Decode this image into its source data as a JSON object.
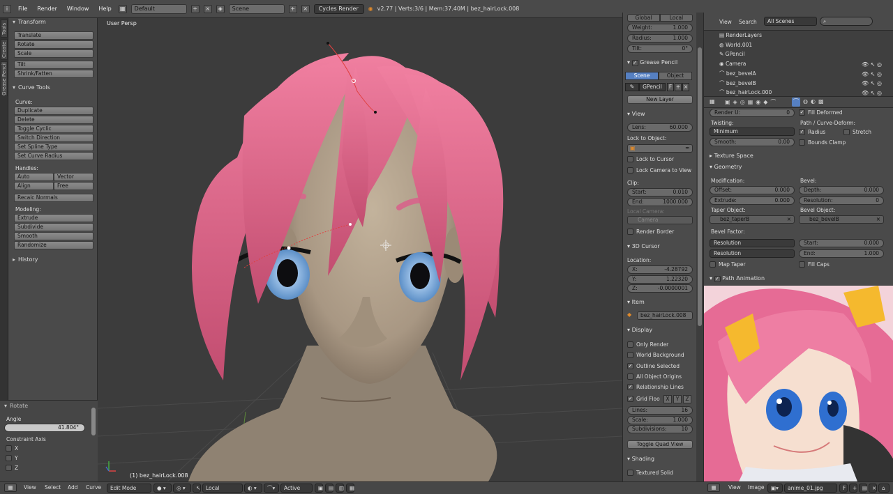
{
  "topbar": {
    "menus": [
      "File",
      "Render",
      "Window",
      "Help"
    ],
    "layout": "Default",
    "scene": "Scene",
    "engine": "Cycles Render",
    "info": "v2.77 | Verts:3/6 | Mem:37.40M | bez_hairLock.008"
  },
  "vtabs": [
    "Tools",
    "Create",
    "Grease Pencil"
  ],
  "toolshelf": {
    "transform_header": "Transform",
    "transform_buttons": [
      "Translate",
      "Rotate",
      "Scale",
      "Tilt",
      "Shrink/Fatten"
    ],
    "curve_tools_header": "Curve Tools",
    "curve_label": "Curve:",
    "curve_buttons": [
      "Duplicate",
      "Delete",
      "Toggle Cyclic",
      "Switch Direction",
      "Set Spline Type",
      "Set Curve Radius"
    ],
    "handles_label": "Handles:",
    "handles": [
      "Auto",
      "Vector",
      "Align",
      "Free"
    ],
    "recalc": "Recalc Normals",
    "modeling_label": "Modeling:",
    "modeling_buttons": [
      "Extrude",
      "Subdivide",
      "Smooth",
      "Randomize"
    ],
    "history_header": "History",
    "rotate_header": "Rotate",
    "angle_label": "Angle",
    "angle_value": "41.804°",
    "constraint_label": "Constraint Axis",
    "axes": [
      "X",
      "Y",
      "Z"
    ]
  },
  "viewport": {
    "view_label": "User Persp",
    "object_label": "(1) bez_hairLock.008"
  },
  "npanel": {
    "tabs": [
      "Global",
      "Local"
    ],
    "weight": {
      "label": "Weight:",
      "value": "1.000"
    },
    "radius": {
      "label": "Radius:",
      "value": "1.000"
    },
    "tilt": {
      "label": "Tilt:",
      "value": "0°"
    },
    "grease_header": "Grease Pencil",
    "grease_tabs": [
      "Scene",
      "Object"
    ],
    "gpencil": "GPencil",
    "gpencil_f": "F",
    "new_layer": "New Layer",
    "view_header": "View",
    "lens": {
      "label": "Lens:",
      "value": "60.000"
    },
    "lock_label": "Lock to Object:",
    "lock_cursor": "Lock to Cursor",
    "lock_camera": "Lock Camera to View",
    "clip_label": "Clip:",
    "clip_start": {
      "label": "Start:",
      "value": "0.010"
    },
    "clip_end": {
      "label": "End:",
      "value": "1000.000"
    },
    "local_camera": "Local Camera:",
    "camera": "Camera",
    "render_border": "Render Border",
    "cursor_header": "3D Cursor",
    "location_label": "Location:",
    "cx": {
      "label": "X:",
      "value": "-4.28792"
    },
    "cy": {
      "label": "Y:",
      "value": "1.22320"
    },
    "cz": {
      "label": "Z:",
      "value": "-0.0000001"
    },
    "item_header": "Item",
    "item_name": "bez_hairLock.008",
    "display_header": "Display",
    "display_checks": [
      {
        "label": "Only Render",
        "checked": false
      },
      {
        "label": "World Background",
        "checked": false
      },
      {
        "label": "Outline Selected",
        "checked": true
      },
      {
        "label": "All Object Origins",
        "checked": false
      },
      {
        "label": "Relationship Lines",
        "checked": true
      }
    ],
    "grid_floor": "Grid Floo",
    "grid_axes": [
      "X",
      "Y",
      "Z"
    ],
    "lines": {
      "label": "Lines:",
      "value": "16"
    },
    "scale": {
      "label": "Scale:",
      "value": "1.000"
    },
    "subdivisions": {
      "label": "Subdivisions:",
      "value": "10"
    },
    "quad_view": "Toggle Quad View",
    "shading_header": "Shading",
    "textured_solid": "Textured Solid"
  },
  "outliner": {
    "menus": [
      "View",
      "Search"
    ],
    "scenes": "All Scenes",
    "rows": [
      "RenderLayers",
      "World.001",
      "GPencil",
      "Camera",
      "bez_bevelA",
      "bez_bevelB",
      "bez_hairLock.000"
    ]
  },
  "props": {
    "render_u": {
      "label": "Render U:",
      "value": "0"
    },
    "fill_deformed": "Fill Deformed",
    "twisting_label": "Twisting:",
    "twisting": "Minimum",
    "path_label": "Path / Curve-Deform:",
    "radius_chk": "Radius",
    "stretch_chk": "Stretch",
    "smooth": {
      "label": "Smooth:",
      "value": "0.00"
    },
    "bounds_clamp": "Bounds Clamp",
    "texture_space": "Texture Space",
    "geometry": "Geometry",
    "modification_label": "Modification:",
    "bevel_label": "Bevel:",
    "offset": {
      "label": "Offset:",
      "value": "0.000"
    },
    "depth": {
      "label": "Depth:",
      "value": "0.000"
    },
    "extrude": {
      "label": "Extrude:",
      "value": "0.000"
    },
    "resolution": {
      "label": "Resolution:",
      "value": "0"
    },
    "taper_label": "Taper Object:",
    "bevel_obj_label": "Bevel Object:",
    "taper_obj": "bez_taperB",
    "bevel_obj": "bez_bevelB",
    "bevel_factor_label": "Bevel Factor:",
    "res_drop1": "Resolution",
    "res_drop2": "Resolution",
    "bf_start": {
      "label": "Start:",
      "value": "0.000"
    },
    "bf_end": {
      "label": "End:",
      "value": "1.000"
    },
    "map_taper": "Map Taper",
    "fill_caps": "Fill Caps",
    "path_animation": "Path Animation"
  },
  "bottombar": {
    "menus": [
      "View",
      "Select",
      "Add",
      "Curve"
    ],
    "mode": "Edit Mode",
    "orientation": "Local",
    "pivot": "Active",
    "right_menus": [
      "View",
      "Image"
    ],
    "image_name": "anime_01.jpg",
    "image_f": "F"
  }
}
